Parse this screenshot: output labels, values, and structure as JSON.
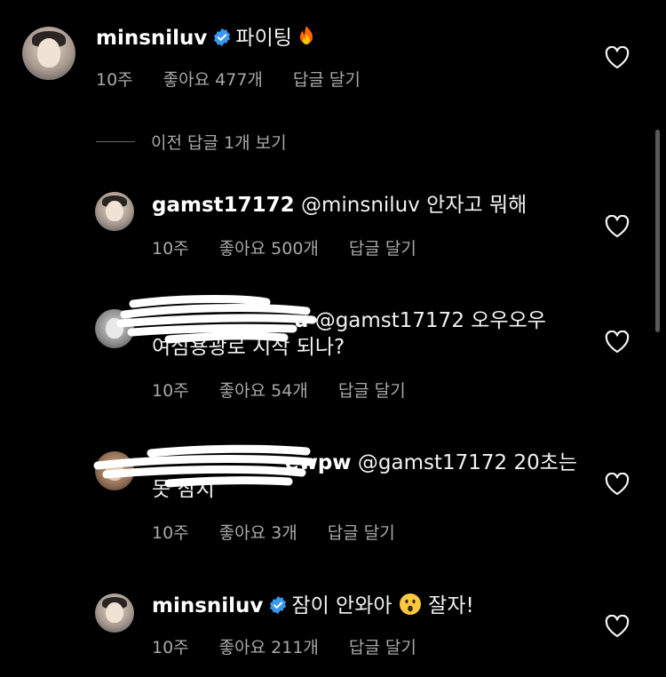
{
  "comments": [
    {
      "username": "minsniluv",
      "verified": true,
      "text": "파이팅",
      "emoji": "🔥",
      "time": "10주",
      "likes": "좋아요 477개",
      "reply": "답글 달기"
    },
    {
      "username": "gamst17172",
      "verified": false,
      "text": "@minsniluv 안자고 뭐해",
      "time": "10주",
      "likes": "좋아요 500개",
      "reply": "답글 달기"
    },
    {
      "username_visible_suffix": "u",
      "text_line1": "@gamst17172 오우오우",
      "text_line2": "여심용광로 시작 되나?",
      "time": "10주",
      "likes": "좋아요 54개",
      "reply": "답글 달기"
    },
    {
      "username_visible_suffix": "ewpw",
      "text_line1": "@gamst17172 20초는",
      "text_line2": "못 참지",
      "time": "10주",
      "likes": "좋아요 3개",
      "reply": "답글 달기"
    },
    {
      "username": "minsniluv",
      "verified": true,
      "text": "잠이 안와아",
      "emoji": "😮",
      "text_after_emoji": "잘자!",
      "time": "10주",
      "likes": "좋아요 211개",
      "reply": "답글 달기"
    }
  ],
  "view_previous_replies": "이전 답글 1개 보기",
  "colors": {
    "background": "#000000",
    "text": "#f5f5f5",
    "meta": "#a8a8a8",
    "verified_badge": "#3897f0"
  },
  "icons": [
    "heart-icon",
    "verified-badge-icon",
    "fire-emoji",
    "surprised-emoji"
  ]
}
